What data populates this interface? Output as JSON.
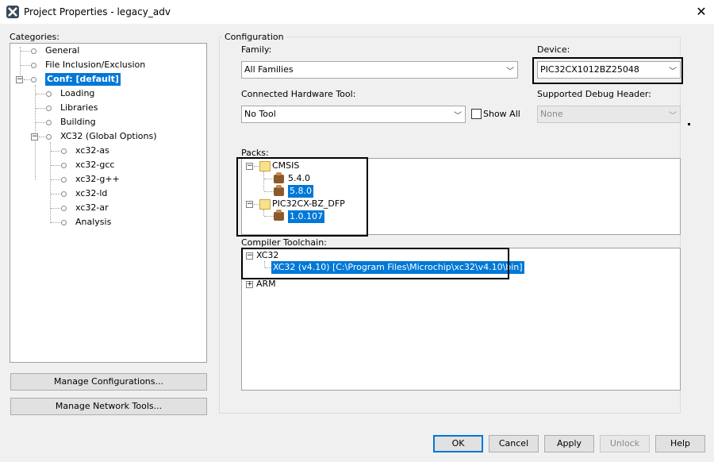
{
  "window": {
    "title": "Project Properties - legacy_adv"
  },
  "categories": {
    "label": "Categories:",
    "items": [
      {
        "label": "General"
      },
      {
        "label": "File Inclusion/Exclusion"
      },
      {
        "label": "Conf: [default]"
      },
      {
        "label": "Loading"
      },
      {
        "label": "Libraries"
      },
      {
        "label": "Building"
      },
      {
        "label": "XC32 (Global Options)"
      },
      {
        "label": "xc32-as"
      },
      {
        "label": "xc32-gcc"
      },
      {
        "label": "xc32-g++"
      },
      {
        "label": "xc32-ld"
      },
      {
        "label": "xc32-ar"
      },
      {
        "label": "Analysis"
      }
    ],
    "manage_configurations": "Manage Configurations...",
    "manage_network_tools": "Manage Network Tools..."
  },
  "configuration": {
    "group_label": "Configuration",
    "family_label": "Family:",
    "family_value": "All Families",
    "device_label": "Device:",
    "device_value": "PIC32CX1012BZ25048",
    "hw_tool_label": "Connected Hardware Tool:",
    "hw_tool_value": "No Tool",
    "show_all_label": "Show All",
    "debug_header_label": "Supported Debug Header:",
    "debug_header_value": "None",
    "packs_label": "Packs:",
    "packs": {
      "cmsis": "CMSIS",
      "cmsis_v1": "5.4.0",
      "cmsis_v2": "5.8.0",
      "dfp": "PIC32CX-BZ_DFP",
      "dfp_v1": "1.0.107"
    },
    "toolchain_label": "Compiler Toolchain:",
    "toolchain": {
      "xc32": "XC32",
      "xc32_entry": "XC32 (v4.10) [C:\\Program Files\\Microchip\\xc32\\v4.10\\bin]",
      "arm": "ARM"
    }
  },
  "buttons": {
    "ok": "OK",
    "cancel": "Cancel",
    "apply": "Apply",
    "unlock": "Unlock",
    "help": "Help"
  }
}
